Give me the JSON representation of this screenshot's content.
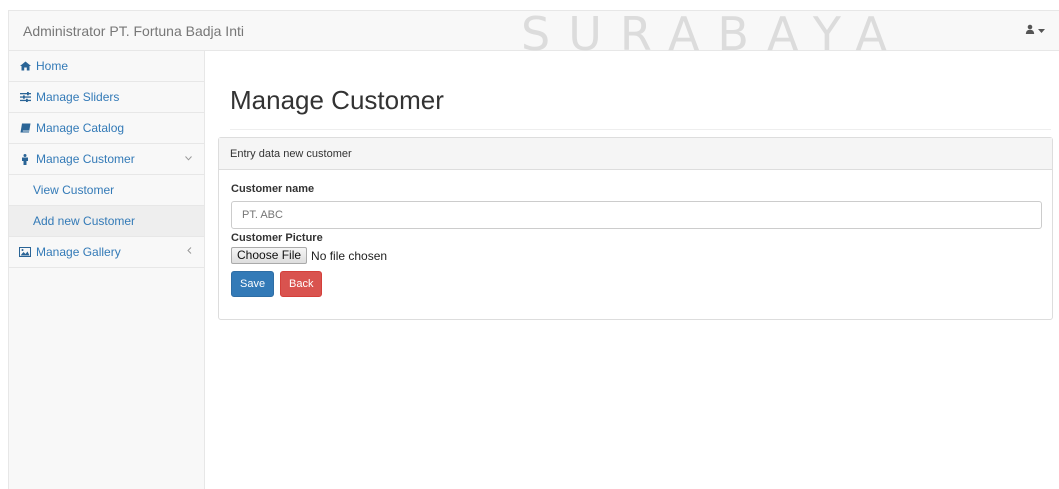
{
  "navbar": {
    "brand": "Administrator PT. Fortuna Badja Inti",
    "watermark": "SURABAYA",
    "user_icon": "user-icon",
    "caret_icon": "caret-down-icon"
  },
  "sidebar": {
    "items": [
      {
        "label": "Home",
        "icon": "home-icon"
      },
      {
        "label": "Manage Sliders",
        "icon": "sliders-icon"
      },
      {
        "label": "Manage Catalog",
        "icon": "book-icon"
      },
      {
        "label": "Manage Customer",
        "icon": "male-icon",
        "expanded": true
      },
      {
        "label": "View Customer"
      },
      {
        "label": "Add new Customer",
        "active": true
      },
      {
        "label": "Manage Gallery",
        "icon": "picture-icon"
      }
    ]
  },
  "main": {
    "title": "Manage Customer",
    "panel_heading": "Entry data new customer",
    "customer_name_label": "Customer name",
    "customer_name_placeholder": "PT. ABC",
    "customer_picture_label": "Customer Picture",
    "choose_file_label": "Choose File",
    "file_status": "No file chosen",
    "save_label": "Save",
    "back_label": "Back"
  },
  "colors": {
    "link": "#337ab7",
    "save_button": "#337ab7",
    "back_button": "#d9534f"
  }
}
